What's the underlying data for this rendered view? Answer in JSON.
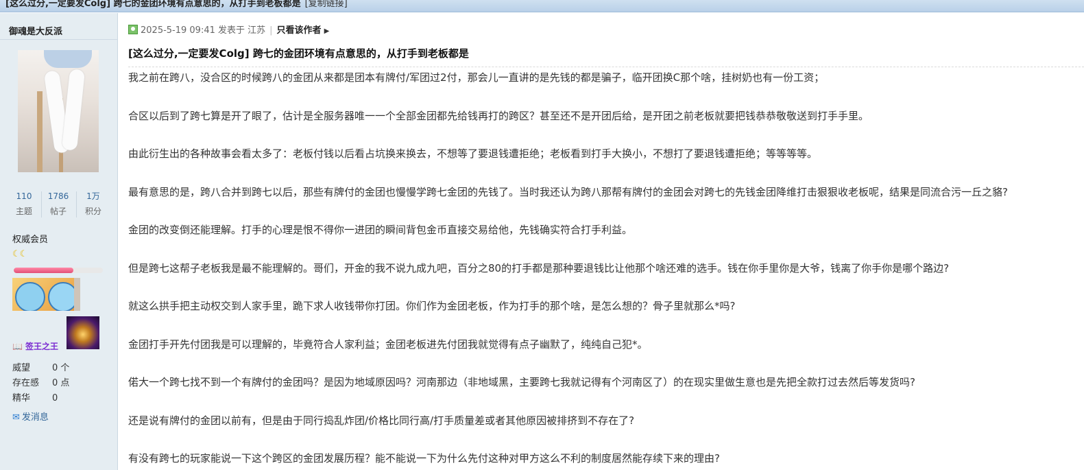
{
  "page_title_bar": {
    "title": "[这么过分,一定要发Colg] 跨七的金团环境有点意思的，从打手到老板都是",
    "copy_link": "[复制链接]"
  },
  "author": {
    "name": "御魂是大反派",
    "stats": [
      {
        "value": "110",
        "label": "主题"
      },
      {
        "value": "1786",
        "label": "帖子"
      },
      {
        "value": "1万",
        "label": "积分"
      }
    ],
    "rank": "权威会员",
    "rank_icons": "☾☾",
    "rank_progress": 0.67,
    "medal_name": "签王之王",
    "info": [
      {
        "key": "威望",
        "value": "0 个"
      },
      {
        "key": "存在感",
        "value": "0 点"
      },
      {
        "key": "精华",
        "value": "0"
      }
    ],
    "send_message": "发消息"
  },
  "post": {
    "meta": {
      "date": "2025-5-19 09:41",
      "published_in": "发表于 江苏",
      "only_author": "只看该作者"
    },
    "title": "[这么过分,一定要发Colg] 跨七的金团环境有点意思的，从打手到老板都是",
    "paragraphs": [
      "我之前在跨八，没合区的时候跨八的金团从来都是团本有牌付/军团过2付，那会儿一直讲的是先钱的都是骗子，临开团换C那个啥，挂树奶也有一份工资；",
      "合区以后到了跨七算是开了眼了，估计是全服务器唯一一个全部金团都先给钱再打的跨区？甚至还不是开团后给，是开团之前老板就要把钱恭恭敬敬送到打手手里。",
      "由此衍生出的各种故事会看太多了：老板付钱以后看占坑换来换去，不想等了要退钱遭拒绝；老板看到打手大换小，不想打了要退钱遭拒绝；等等等等。",
      "最有意思的是，跨八合并到跨七以后，那些有牌付的金团也慢慢学跨七金团的先钱了。当时我还认为跨八那帮有牌付的金团会对跨七的先钱金团降维打击狠狠收老板呢，结果是同流合污一丘之貉?",
      "金团的改变倒还能理解。打手的心理是恨不得你一进团的瞬间背包金币直接交易给他，先钱确实符合打手利益。",
      "但是跨七这帮子老板我是最不能理解的。哥们，开金的我不说九成九吧，百分之80的打手都是那种要退钱比让他那个啥还难的选手。钱在你手里你是大爷，钱离了你手你是哪个路边?",
      "就这么拱手把主动权交到人家手里，跪下求人收钱带你打团。你们作为金团老板，作为打手的那个啥，是怎么想的？骨子里就那么*吗?",
      "金团打手开先付团我是可以理解的，毕竟符合人家利益；金团老板进先付团我就觉得有点子幽默了，纯纯自己犯*。",
      "偌大一个跨七找不到一个有牌付的金团吗？是因为地域原因吗？河南那边（非地域黑，主要跨七我就记得有个河南区了）的在现实里做生意也是先把全款打过去然后等发货吗?",
      "还是说有牌付的金团以前有，但是由于同行捣乱炸团/价格比同行高/打手质量差或者其他原因被排挤到不存在了?",
      "有没有跨七的玩家能说一下这个跨区的金团发展历程？能不能说一下为什么先付这种对甲方这么不利的制度居然能存续下来的理由?"
    ]
  }
}
